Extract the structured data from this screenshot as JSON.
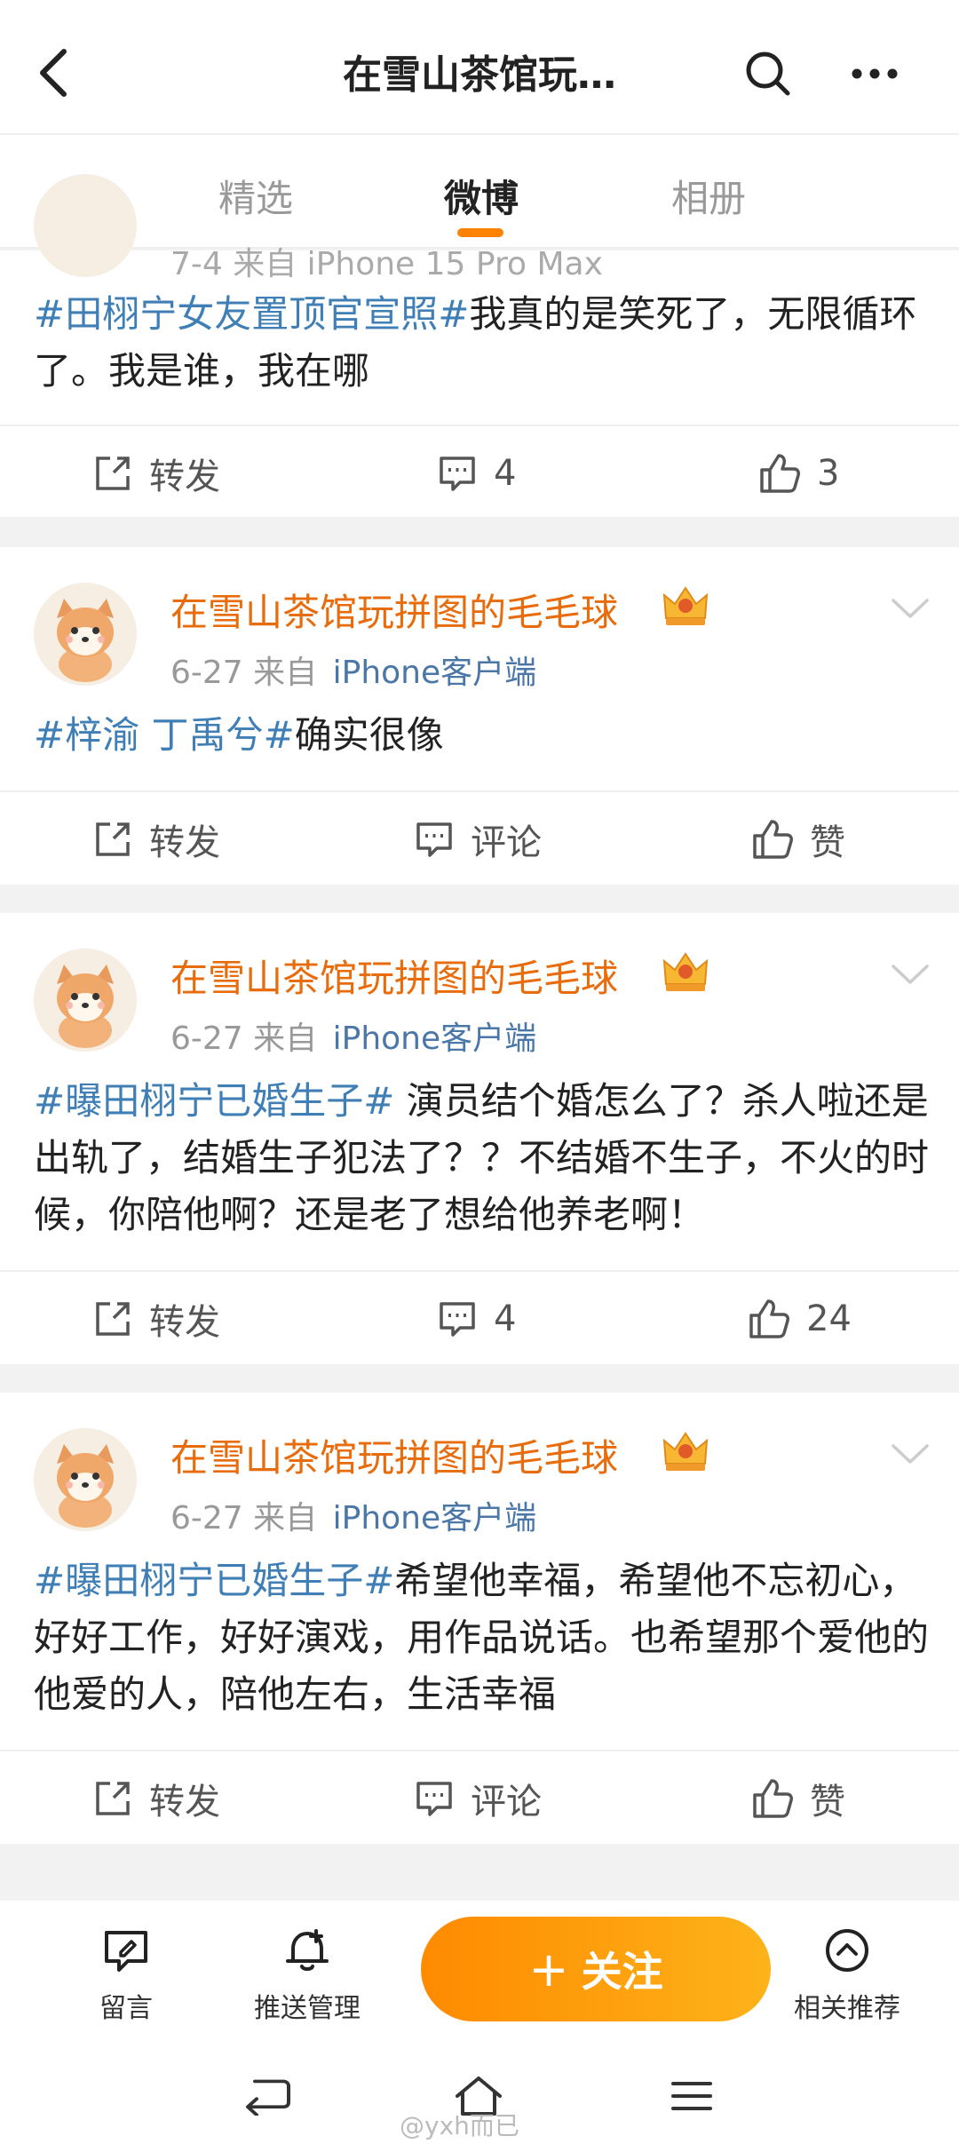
{
  "nav": {
    "title": "在雪山茶馆玩…"
  },
  "tabs": [
    {
      "label": "精选"
    },
    {
      "label": "微博"
    },
    {
      "label": "相册"
    }
  ],
  "cutoff_meta": "7-4  来自 iPhone 15 Pro Max",
  "posts": [
    {
      "tag": "#田栩宁女友置顶官宣照#",
      "text": "我真的是笑死了，无限循环了。我是谁，我在哪",
      "repost": "转发",
      "comment": "4",
      "like": "3"
    },
    {
      "username": "在雪山茶馆玩拼图的毛毛球",
      "date": "6-27",
      "from": "来自",
      "source": "iPhone客户端",
      "tag": "#梓渝 丁禹兮#",
      "text": "确实很像",
      "repost": "转发",
      "comment": "评论",
      "like": "赞"
    },
    {
      "username": "在雪山茶馆玩拼图的毛毛球",
      "date": "6-27",
      "from": "来自",
      "source": "iPhone客户端",
      "tag": "#曝田栩宁已婚生子#",
      "text": " 演员结个婚怎么了？杀人啦还是出轨了，结婚生子犯法了？？不结婚不生子，不火的时候，你陪他啊？还是老了想给他养老啊！",
      "repost": "转发",
      "comment": "4",
      "like": "24"
    },
    {
      "username": "在雪山茶馆玩拼图的毛毛球",
      "date": "6-27",
      "from": "来自",
      "source": "iPhone客户端",
      "tag": "#曝田栩宁已婚生子#",
      "text": "希望他幸福，希望他不忘初心，好好工作，好好演戏，用作品说话。也希望那个爱他的他爱的人，陪他左右，生活幸福",
      "repost": "转发",
      "comment": "评论",
      "like": "赞"
    }
  ],
  "bottom": {
    "message": "留言",
    "push": "推送管理",
    "follow": "关注",
    "follow_plus": "+",
    "related": "相关推荐"
  },
  "watermark": "@yxh而已",
  "colors": {
    "accent": "#ff8200",
    "username": "#e86b0c",
    "tag": "#3f7fb5"
  }
}
